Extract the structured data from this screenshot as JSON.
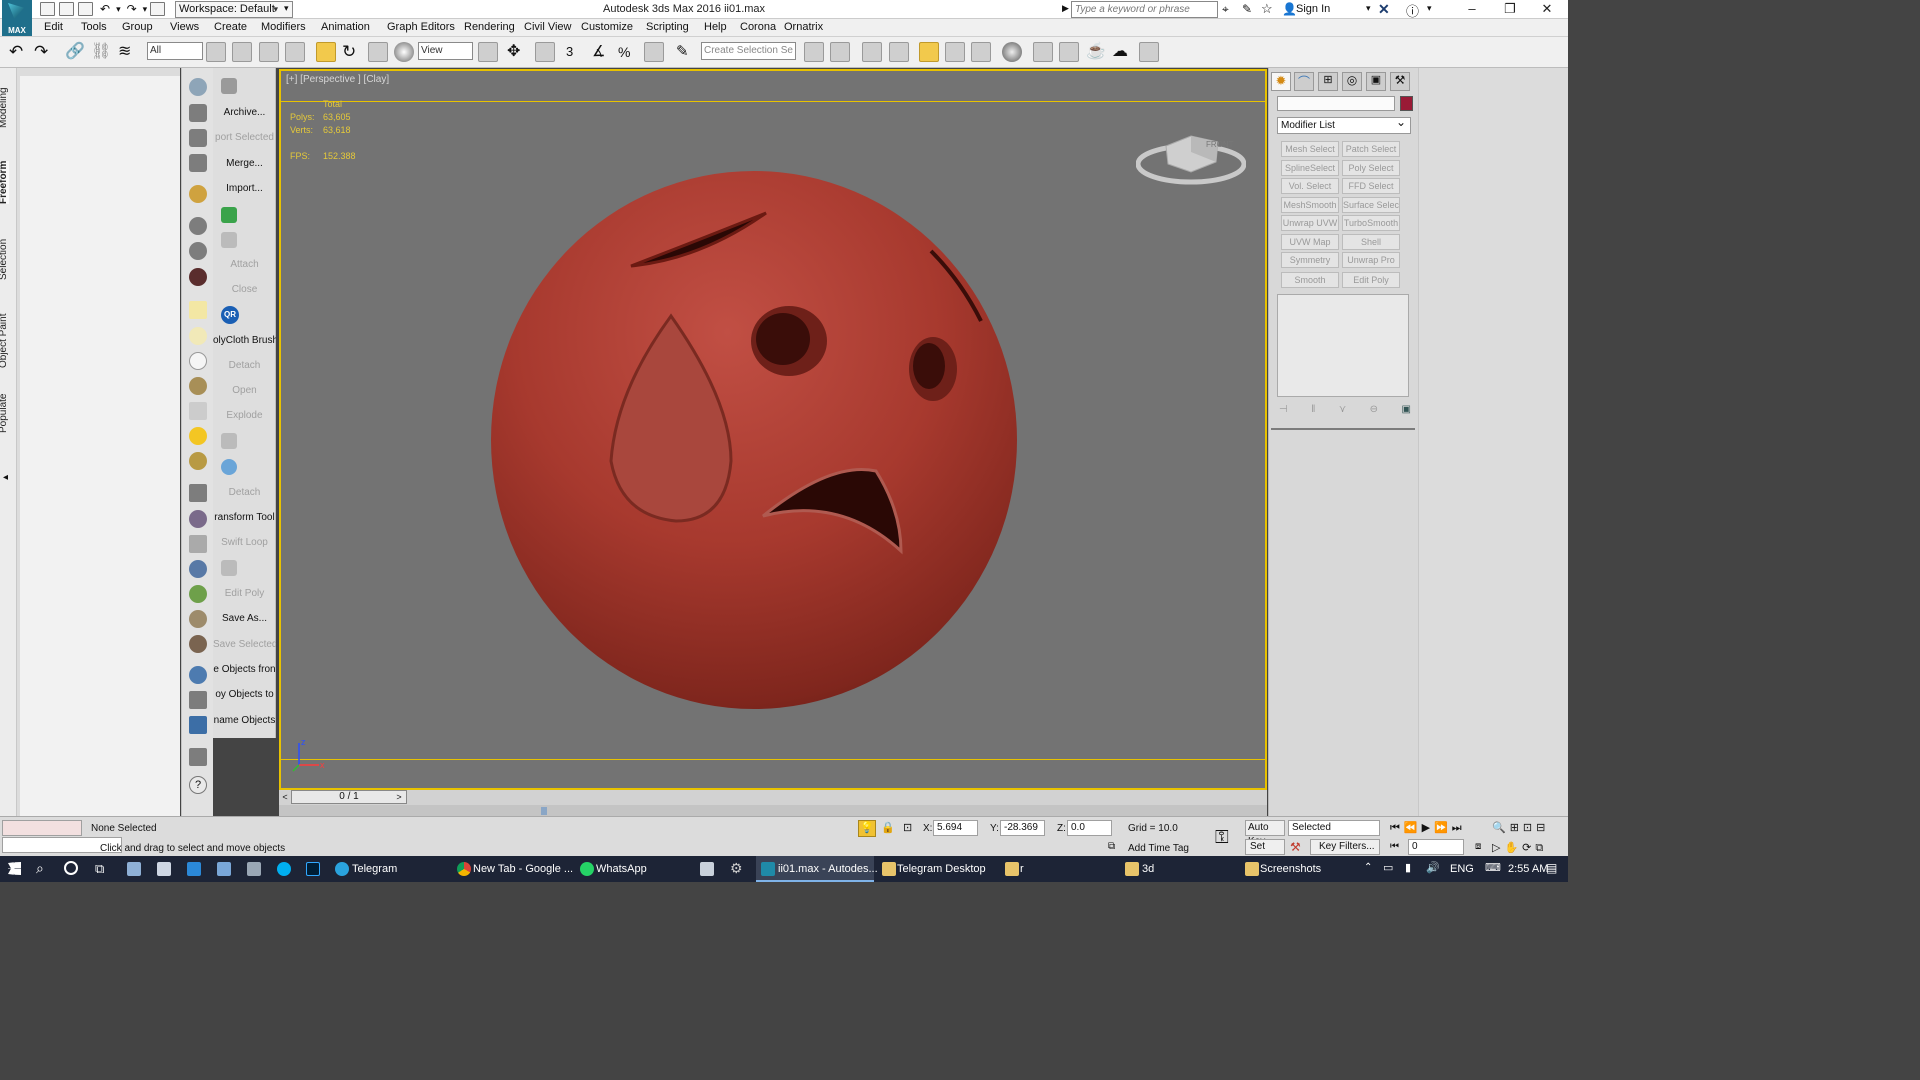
{
  "app": {
    "logo_label": "MAX",
    "workspace_label": "Workspace: Default",
    "window_title": "Autodesk 3ds Max 2016     ii01.max",
    "search_placeholder": "Type a keyword or phrase",
    "sign_in": "Sign In"
  },
  "menu": [
    "Edit",
    "Tools",
    "Group",
    "Views",
    "Create",
    "Modifiers",
    "Animation",
    "Graph Editors",
    "Rendering",
    "Civil View",
    "Customize",
    "Scripting",
    "Help",
    "Corona",
    "Ornatrix"
  ],
  "toolbar": {
    "filter_value": "All",
    "view_value": "View",
    "selection_set_placeholder": "Create Selection Se"
  },
  "ribbon_tabs": [
    "Modeling",
    "Freeform",
    "Selection",
    "Object Paint",
    "Populate"
  ],
  "commands": {
    "archive": "Archive...",
    "export_selected": "port Selected",
    "merge": "Merge...",
    "import": "Import...",
    "attach": "Attach",
    "close": "Close",
    "polycloth": "olyCloth Brush",
    "detach1": "Detach",
    "open": "Open",
    "explode": "Explode",
    "detach2": "Detach",
    "transform_tool": "ransform Tool",
    "swift_loop": "Swift Loop",
    "edit_poly": "Edit Poly",
    "save_as": "Save As...",
    "save_selected": "Save Selected",
    "objects_from": "e Objects fron",
    "copy_objects_to": "oy Objects to",
    "rename_objects": "name Objects",
    "qr_label": "QR"
  },
  "viewport": {
    "label": "[+] [Perspective ] [Clay]",
    "stats_header": "Total",
    "polys_label": "Polys:",
    "polys_value": "63,605",
    "verts_label": "Verts:",
    "verts_value": "63,618",
    "fps_label": "FPS:",
    "fps_value": "152.388",
    "viewcube_label": "FRONT",
    "axis_z": "z",
    "axis_x": "x"
  },
  "timeline": {
    "frame": "0 / 1"
  },
  "modifier_panel": {
    "modifier_list": "Modifier List",
    "buttons": [
      [
        "Mesh Select",
        "Patch Select"
      ],
      [
        "SplineSelect",
        "Poly Select"
      ],
      [
        "Vol. Select",
        "FFD Select"
      ],
      [
        "MeshSmooth",
        "Surface Select"
      ],
      [
        "Unwrap UVW",
        "TurboSmooth"
      ],
      [
        "UVW Map",
        "Shell"
      ],
      [
        "Symmetry",
        "Unwrap Pro"
      ],
      [
        "Smooth",
        "Edit Poly"
      ]
    ]
  },
  "status": {
    "selection": "None Selected",
    "prompt": "Click and drag to select and move objects",
    "x_label": "X:",
    "x_value": "5.694",
    "y_label": "Y:",
    "y_value": "-28.369",
    "z_label": "Z:",
    "z_value": "0.0",
    "grid": "Grid = 10.0",
    "add_time_tag": "Add Time Tag",
    "auto_key": "Auto Key",
    "set_key": "Set Key",
    "selected": "Selected",
    "key_filters": "Key Filters...",
    "frame_value": "0"
  },
  "taskbar": {
    "items": [
      "Telegram",
      "New Tab - Google ...",
      "WhatsApp",
      "ii01.max - Autodes...",
      "Telegram Desktop",
      "r",
      "3d",
      "Screenshots"
    ],
    "lang": "ENG",
    "time": "2:55 AM"
  },
  "colors": {
    "viewport_border": "#e8c200",
    "object_color": "#9a1a36",
    "sphere": "#a7392e",
    "stats_text": "#e5c93a"
  }
}
